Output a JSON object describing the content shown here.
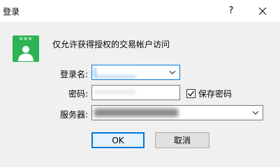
{
  "window": {
    "title": "登录",
    "help_label": "?",
    "close_icon": "close-icon"
  },
  "header": {
    "app_icon": "password-user-icon",
    "stars": "***",
    "prompt": "仅允许获得授权的交易帐户访问"
  },
  "form": {
    "login_label": "登录名:",
    "login_value": "████████",
    "password_label": "密码:",
    "password_value": "••••••••••",
    "save_password_label": "保存密码",
    "save_password_checked": true,
    "server_label": "服务器:",
    "server_value": "███████████████████████"
  },
  "buttons": {
    "ok_label": "OK",
    "cancel_label": "取消"
  },
  "colors": {
    "icon_green": "#2db353",
    "accent": "#0078d7",
    "selection": "#3b8fe8"
  }
}
